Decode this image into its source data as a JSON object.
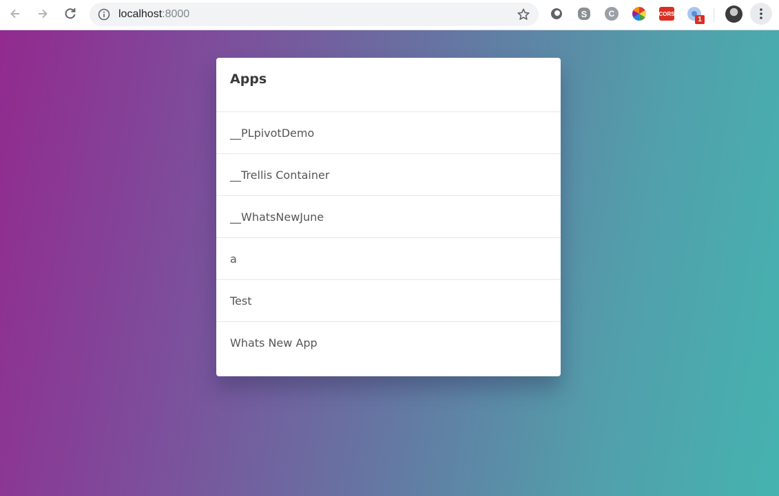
{
  "browser": {
    "url_host": "localhost",
    "url_port": ":8000",
    "extension_badge": "1",
    "cors_label": "CORS",
    "ext_c_label": "C"
  },
  "apps_card": {
    "title": "Apps",
    "items": [
      {
        "label": "__PLpivotDemo"
      },
      {
        "label": "__Trellis Container"
      },
      {
        "label": "__WhatsNewJune"
      },
      {
        "label": "a"
      },
      {
        "label": "Test"
      },
      {
        "label": "Whats New App"
      }
    ]
  },
  "colors": {
    "gradient_start": "#922a8f",
    "gradient_end": "#45b3b0",
    "cors_red": "#d93025"
  }
}
